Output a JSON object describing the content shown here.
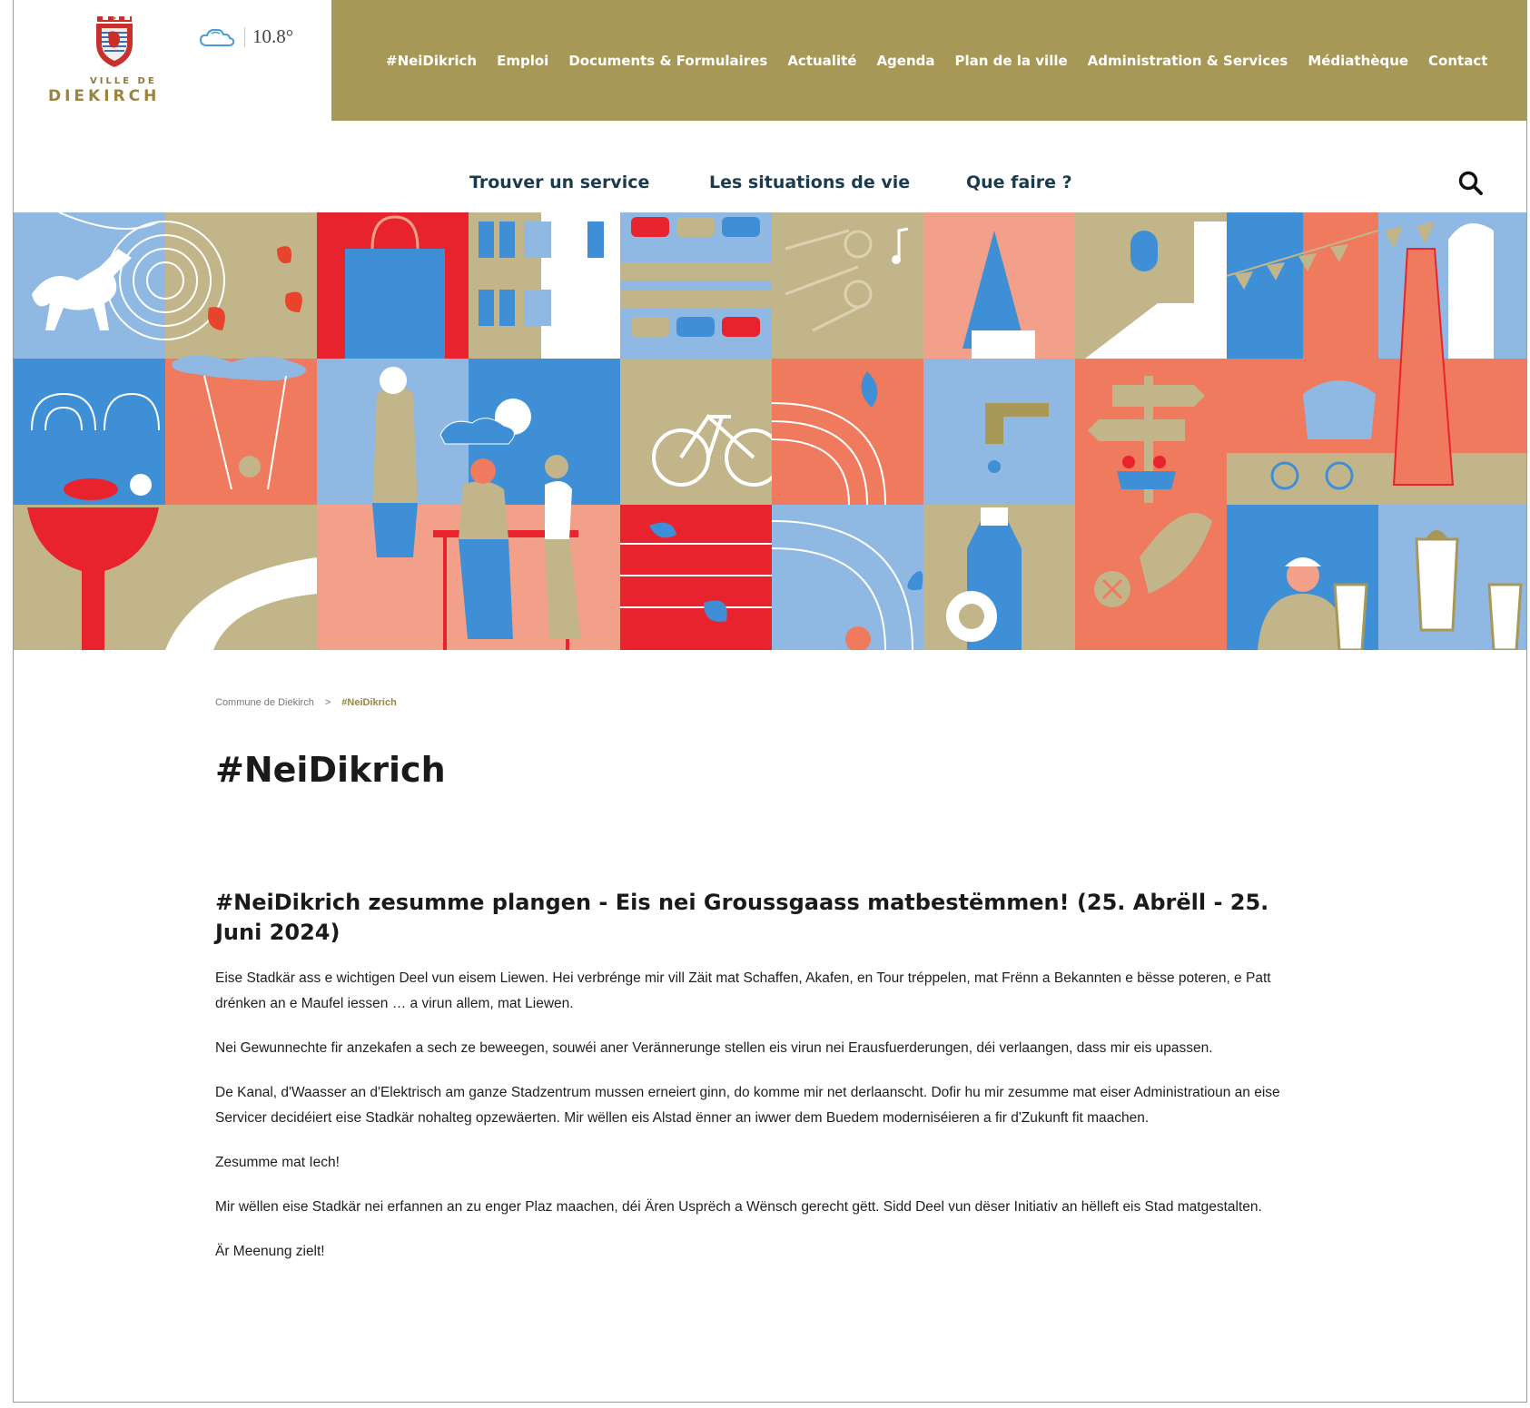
{
  "brand": {
    "logo_small": "VILLE DE",
    "logo_big": "DIEKIRCH",
    "primary_color": "#a79858",
    "dark_text": "#1d3b4f"
  },
  "weather": {
    "icon": "cloud-icon",
    "temperature": "10.8°"
  },
  "main_nav": [
    {
      "label": "#NeiDikrich"
    },
    {
      "label": "Emploi"
    },
    {
      "label": "Documents & Formulaires"
    },
    {
      "label": "Actualité"
    },
    {
      "label": "Agenda"
    },
    {
      "label": "Plan de la ville"
    },
    {
      "label": "Administration & Services"
    },
    {
      "label": "Médiathèque"
    },
    {
      "label": "Contact"
    }
  ],
  "sub_nav": [
    {
      "label": "Trouver un service"
    },
    {
      "label": "Les situations de vie"
    },
    {
      "label": "Que faire ?"
    }
  ],
  "search": {
    "icon": "search-icon"
  },
  "breadcrumb": {
    "home": "Commune de Diekirch",
    "separator": ">",
    "current": "#NeiDikrich"
  },
  "page_title": "#NeiDikrich",
  "article": {
    "title": "#NeiDikrich zesumme plangen - Eis nei Groussgaass matbestëmmen! (25. Abrëll - 25. Juni 2024)",
    "paragraphs": [
      "Eise Stadkär ass e wichtigen Deel vun eisem Liewen. Hei verbréngе mir vill Zäit mat Schaffen, Akafen, en Tour tréppelen, mat Frënn a Bekannten e bësse poteren, e Patt drénken an e Maufel iessen … a virun allem, mat Liewen.",
      "Nei Gewunnechte fir anzekafen a sech ze beweegen, souwéi aner Verännerunge stellen eis virun nei Erausfuerderungen, déi verlaangen, dass mir eis upassen.",
      "De Kanal, d'Waasser an d'Elektrisch am ganze Stadzentrum mussen erneiert ginn, do komme mir net derlaanscht. Dofir hu mir zesumme mat eiser Administratioun an eise Servicer decidéiert eise Stadkär nohalteg opzewäerten. Mir wëllen eis Alstad ënner an iwwer dem Buedem moderniséieren a fir d'Zukunft fit maachen.",
      "Zesumme mat Iech!",
      "Mir wëllen eise Stadkär nei erfannen an zu enger Plaz maachen, déi Ären Usprëch a Wënsch gerecht gëtt. Sidd Deel vun dëser Initiativ an hëlleft eis Stad matgestalten.",
      "Är Meenung zielt!"
    ]
  },
  "banner": {
    "palette": {
      "blue": "#8fb8e3",
      "mid_blue": "#3f8fd6",
      "red": "#e8232d",
      "salmon": "#ef7a5e",
      "pink": "#f2a089",
      "khaki": "#c3b58a",
      "olive": "#a79858"
    }
  }
}
